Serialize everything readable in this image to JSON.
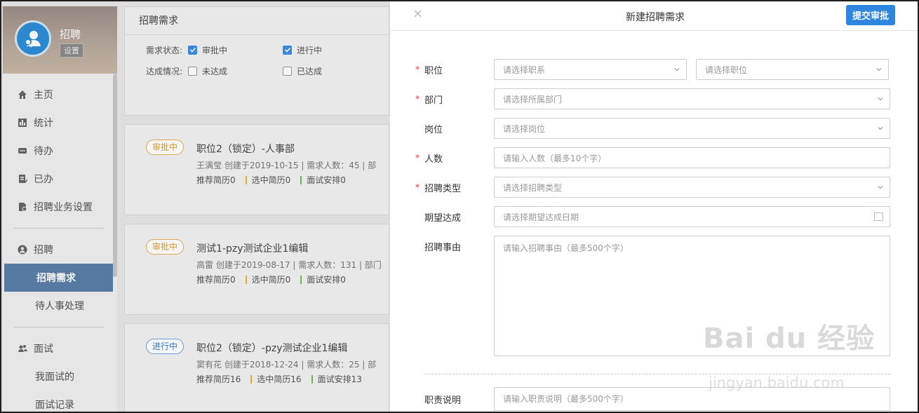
{
  "sidebar": {
    "profile_name": "招聘",
    "profile_settings": "设置",
    "items": [
      {
        "label": "主页",
        "icon": "home-icon"
      },
      {
        "label": "统计",
        "icon": "bar-chart-icon"
      },
      {
        "label": "待办",
        "icon": "todo-icon"
      },
      {
        "label": "已办",
        "icon": "done-icon"
      },
      {
        "label": "招聘业务设置",
        "icon": "settings-doc-icon"
      }
    ],
    "group_recruit": {
      "label": "招聘",
      "icon": "user-circle-icon"
    },
    "recruit_subs": [
      "招聘需求",
      "待人事处理"
    ],
    "group_interview": {
      "label": "面试",
      "icon": "interview-icon"
    },
    "interview_subs": [
      "我面试的",
      "面试记录"
    ]
  },
  "main": {
    "title": "招聘需求",
    "filter": {
      "status_label": "需求状态:",
      "status_options": [
        {
          "label": "审批中",
          "checked": true
        },
        {
          "label": "进行中",
          "checked": true
        }
      ],
      "achieve_label": "达成情况:",
      "achieve_options": [
        {
          "label": "未达成",
          "checked": false
        },
        {
          "label": "已达成",
          "checked": false
        }
      ]
    },
    "cards": [
      {
        "badge": "审批中",
        "title": "职位2（锁定）-人事部",
        "meta": "王满莹   创建于2019-10-15  |   需求人数：45  |   部",
        "stats": [
          "推荐简历0",
          "选中简历0",
          "面试安排0"
        ]
      },
      {
        "badge": "审批中",
        "title": "测试1-pzy测试企业1编辑",
        "meta": "高雷   创建于2019-08-17  |   需求人数：131  |   部门",
        "stats": [
          "推荐简历0",
          "选中简历0",
          "面试安排0"
        ]
      },
      {
        "badge": "进行中",
        "title": "职位2（锁定）-pzy测试企业1编辑",
        "meta": "窦有花   创建于2018-12-24  |   需求人数：25  |   部",
        "stats": [
          "推荐简历16",
          "选中简历16",
          "面试安排13"
        ]
      }
    ]
  },
  "drawer": {
    "close": "×",
    "title": "新建招聘需求",
    "submit": "提交审批",
    "fields": {
      "position": {
        "label": "职位",
        "ph1": "请选择职系",
        "ph2": "请选择职位"
      },
      "department": {
        "label": "部门",
        "ph": "请选择所属部门"
      },
      "post": {
        "label": "岗位",
        "ph": "请选择岗位"
      },
      "headcount": {
        "label": "人数",
        "ph": "请输入人数（最多10个字）"
      },
      "type": {
        "label": "招聘类型",
        "ph": "请选择招聘类型"
      },
      "expected": {
        "label": "期望达成",
        "ph": "请选择期望达成日期"
      },
      "reason": {
        "label": "招聘事由",
        "ph": "请输入招聘事由（最多500个字）"
      },
      "duty": {
        "label": "职责说明",
        "ph": "请输入职责说明（最多500个字）"
      }
    },
    "required_mark": "*"
  },
  "watermark": {
    "brand": "Bai du 经验",
    "url": "jingyan.baidu.com"
  }
}
